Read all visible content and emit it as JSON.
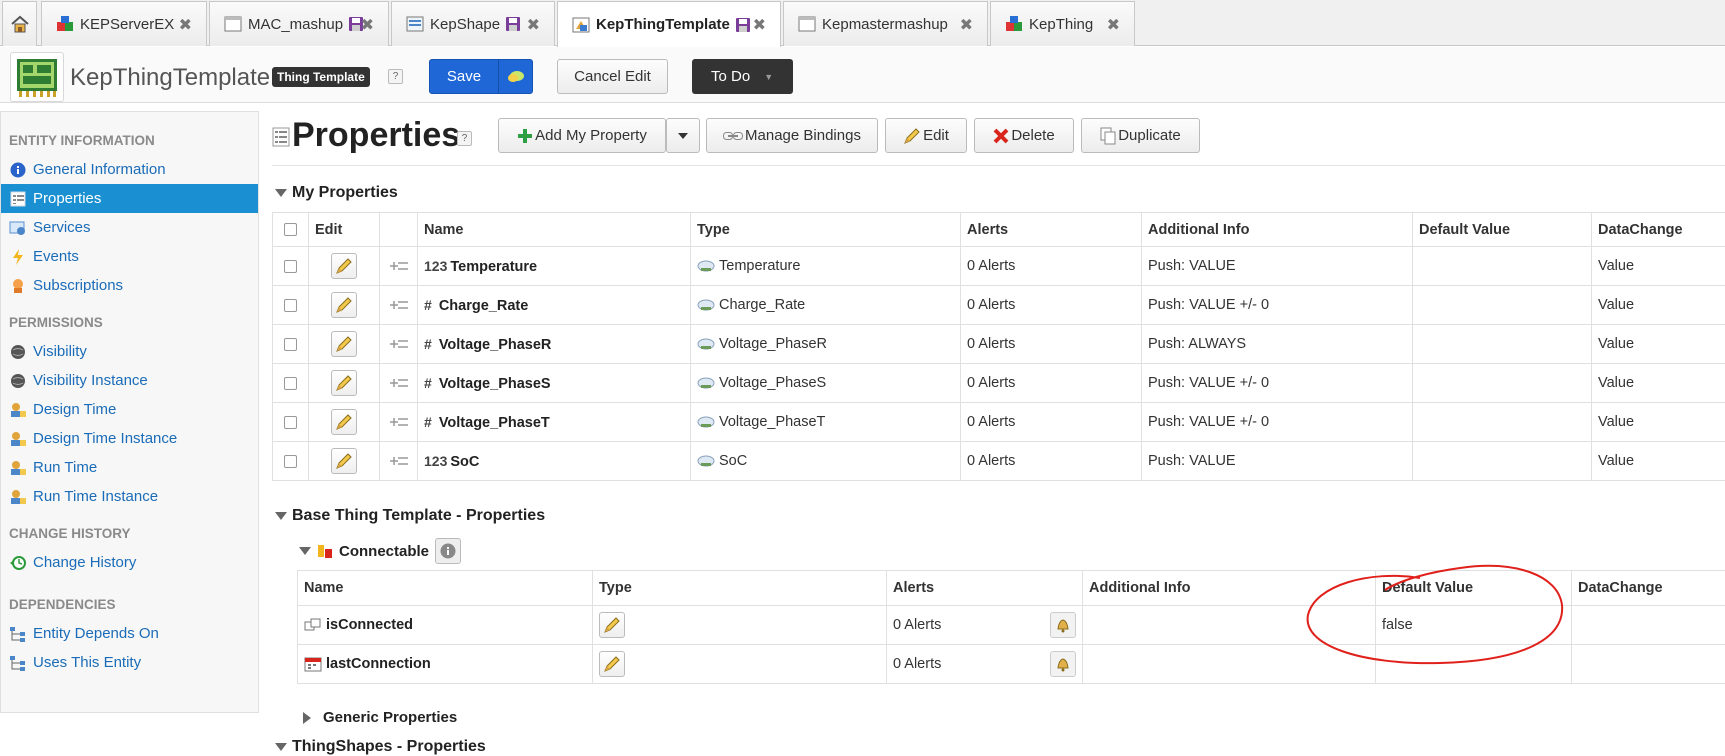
{
  "tabs": [
    {
      "label": "KEPServerEX",
      "icon": "blocks-icon"
    },
    {
      "label": "MAC_mashup",
      "icon": "window-icon",
      "unsaved": true
    },
    {
      "label": "KepShape",
      "icon": "shape-icon",
      "unsaved": true
    },
    {
      "label": "KepThingTemplate",
      "icon": "template-icon",
      "unsaved": true,
      "active": true
    },
    {
      "label": "Kepmastermashup",
      "icon": "window-icon"
    },
    {
      "label": "KepThing",
      "icon": "blocks-icon"
    }
  ],
  "header": {
    "entity_name": "KepThingTemplate",
    "entity_type": "Thing Template",
    "help": "?",
    "save_label": "Save",
    "cancel_label": "Cancel Edit",
    "todo_label": "To Do"
  },
  "sidebar": {
    "sections": [
      {
        "title": "ENTITY INFORMATION",
        "items": [
          "General Information",
          "Properties",
          "Services",
          "Events",
          "Subscriptions"
        ]
      },
      {
        "title": "PERMISSIONS",
        "items": [
          "Visibility",
          "Visibility Instance",
          "Design Time",
          "Design Time Instance",
          "Run Time",
          "Run Time Instance"
        ]
      },
      {
        "title": "CHANGE HISTORY",
        "items": [
          "Change History"
        ]
      },
      {
        "title": "DEPENDENCIES",
        "items": [
          "Entity Depends On",
          "Uses This Entity"
        ]
      }
    ],
    "active_item": "Properties"
  },
  "main": {
    "title": "Properties",
    "help": "?",
    "toolbar": {
      "add": "Add My Property",
      "manage": "Manage Bindings",
      "edit": "Edit",
      "delete": "Delete",
      "duplicate": "Duplicate"
    }
  },
  "my_properties": {
    "title": "My Properties",
    "columns": {
      "edit": "Edit",
      "name": "Name",
      "type": "Type",
      "alerts": "Alerts",
      "info": "Additional Info",
      "default": "Default Value",
      "change": "DataChange"
    },
    "rows": [
      {
        "basetype": "123",
        "name": "Temperature",
        "type": "Temperature",
        "alerts": "0 Alerts",
        "info": "Push: VALUE",
        "default": "",
        "change": "Value"
      },
      {
        "basetype": "#",
        "name": "Charge_Rate",
        "type": "Charge_Rate",
        "alerts": "0 Alerts",
        "info": "Push: VALUE +/- 0",
        "default": "",
        "change": "Value"
      },
      {
        "basetype": "#",
        "name": "Voltage_PhaseR",
        "type": "Voltage_PhaseR",
        "alerts": "0 Alerts",
        "info": "Push: ALWAYS",
        "default": "",
        "change": "Value"
      },
      {
        "basetype": "#",
        "name": "Voltage_PhaseS",
        "type": "Voltage_PhaseS",
        "alerts": "0 Alerts",
        "info": "Push: VALUE +/- 0",
        "default": "",
        "change": "Value"
      },
      {
        "basetype": "#",
        "name": "Voltage_PhaseT",
        "type": "Voltage_PhaseT",
        "alerts": "0 Alerts",
        "info": "Push: VALUE +/- 0",
        "default": "",
        "change": "Value"
      },
      {
        "basetype": "123",
        "name": "SoC",
        "type": "SoC",
        "alerts": "0 Alerts",
        "info": "Push: VALUE",
        "default": "",
        "change": "Value"
      }
    ]
  },
  "base_template": {
    "title": "Base Thing Template - Properties",
    "group": "Connectable",
    "columns": {
      "name": "Name",
      "type": "Type",
      "alerts": "Alerts",
      "info": "Additional Info",
      "default": "Default Value",
      "change": "DataChange"
    },
    "rows": [
      {
        "name": "isConnected",
        "alerts": "0 Alerts",
        "info": "",
        "default": "false",
        "change": ""
      },
      {
        "name": "lastConnection",
        "alerts": "0 Alerts",
        "info": "",
        "default": "",
        "change": ""
      }
    ],
    "generic": "Generic Properties"
  },
  "next_section": "ThingShapes - Properties",
  "colors": {
    "accent": "#1a90d2",
    "save": "#1f66d6",
    "annotation": "#e0201b"
  }
}
